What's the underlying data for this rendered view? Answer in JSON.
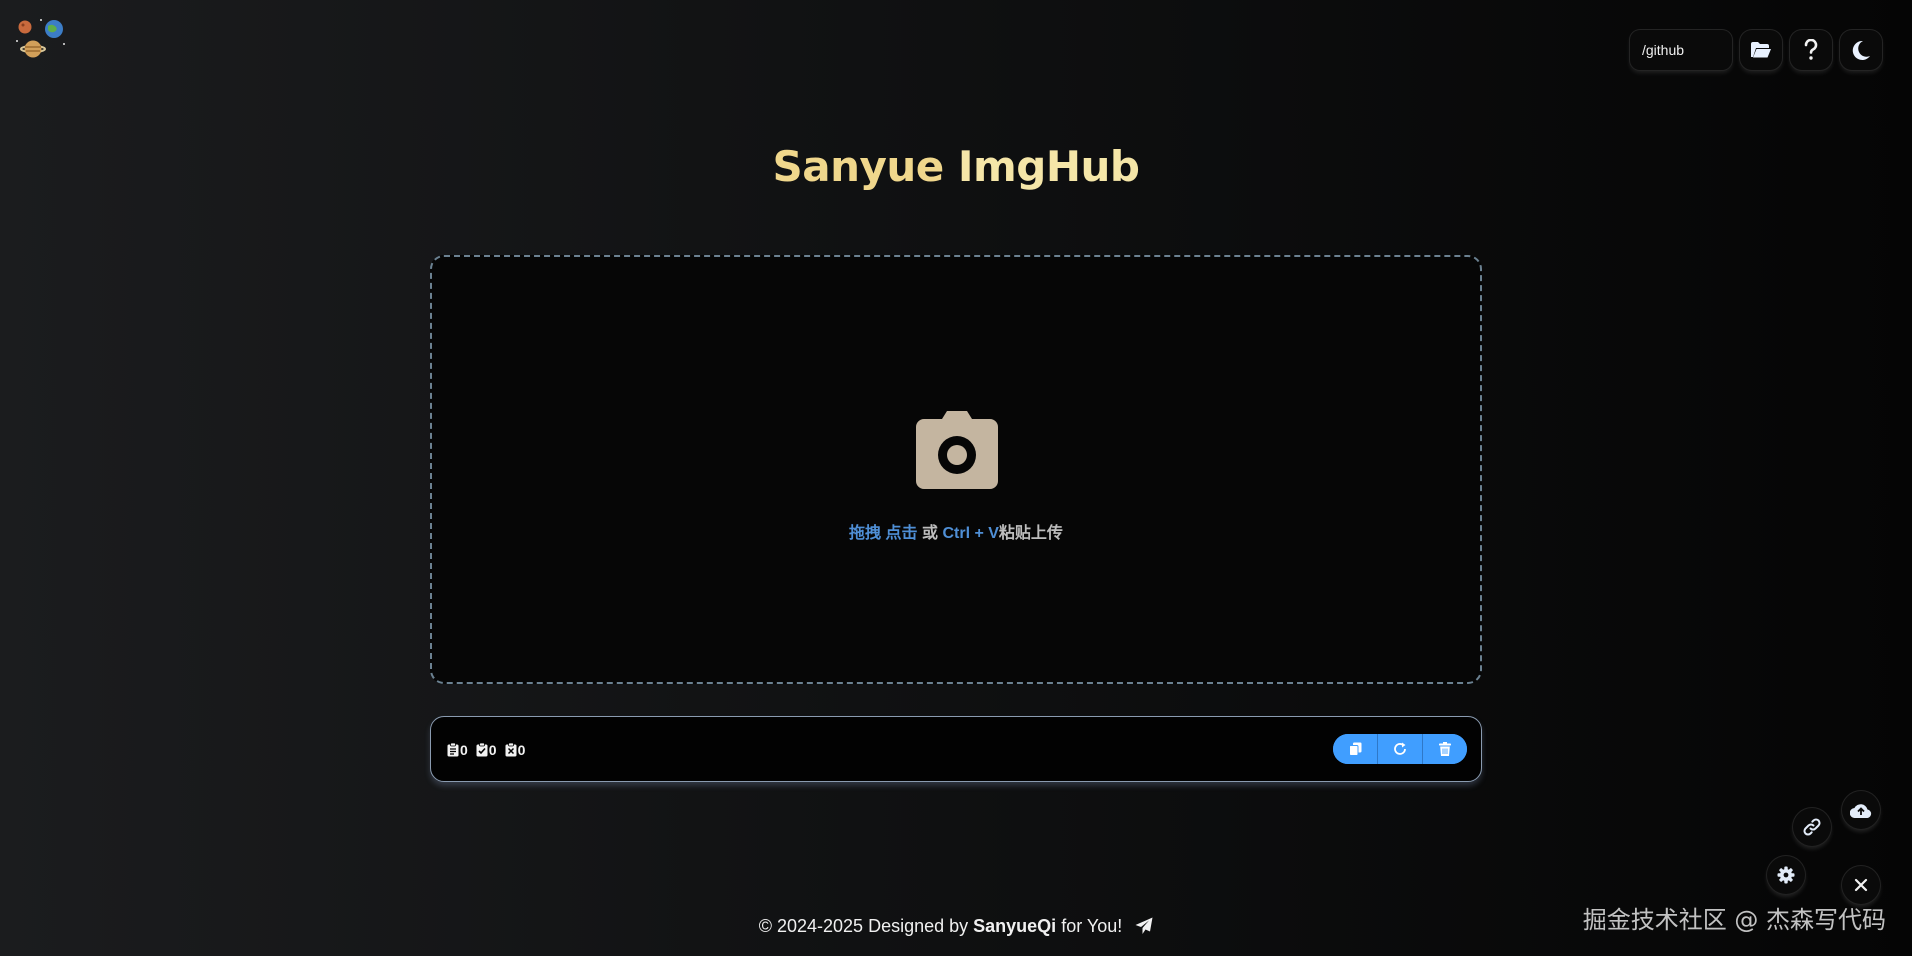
{
  "header": {
    "path_input": {
      "value": "/github"
    },
    "buttons": [
      {
        "icon": "folder-open-icon"
      },
      {
        "icon": "question-icon"
      },
      {
        "icon": "moon-icon"
      }
    ]
  },
  "title": {
    "part1": "Sanyue",
    "part2": "ImgHub"
  },
  "upload": {
    "icon": "camera-icon",
    "hint": {
      "drag": "拖拽",
      "click": "点击",
      "or": "或",
      "shortcut": "Ctrl + V",
      "paste": "粘贴上传"
    }
  },
  "result_bar": {
    "counters": [
      {
        "icon": "clipboard-list-icon",
        "value": "0"
      },
      {
        "icon": "clipboard-check-icon",
        "value": "0"
      },
      {
        "icon": "clipboard-x-icon",
        "value": "0"
      }
    ],
    "actions": [
      {
        "icon": "copy-icon"
      },
      {
        "icon": "refresh-icon"
      },
      {
        "icon": "trash-icon"
      }
    ]
  },
  "floating": [
    {
      "icon": "cloud-upload-icon"
    },
    {
      "icon": "link-icon"
    },
    {
      "icon": "gear-icon"
    },
    {
      "icon": "close-icon"
    }
  ],
  "footer": {
    "prefix": "© 2024-2025 Designed by",
    "author": "SanyueQi",
    "suffix": "for You!",
    "icon": "paper-plane-icon"
  },
  "watermark": "掘金技术社区 @ 杰森写代码",
  "colors": {
    "accent_blue": "#409eff",
    "title_gold": "#f0d78c",
    "hint_blue": "#4f8fd6",
    "camera": "#c4b5a0"
  }
}
